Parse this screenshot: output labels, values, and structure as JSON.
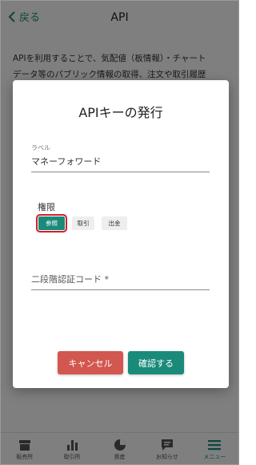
{
  "header": {
    "back_label": "戻る",
    "title": "API"
  },
  "background": {
    "line1": "APIを利用することで、気配値（板情報）・チャート",
    "line2": "データ等のパブリック情報の取得、注文や取引履歴"
  },
  "tabbar": {
    "tabs": [
      {
        "label": "販売所",
        "icon": "store-icon"
      },
      {
        "label": "取引所",
        "icon": "bar-chart-icon"
      },
      {
        "label": "資産",
        "icon": "pie-chart-icon"
      },
      {
        "label": "お知らせ",
        "icon": "message-icon"
      },
      {
        "label": "メニュー",
        "icon": "menu-icon"
      }
    ],
    "active_index": 4
  },
  "modal": {
    "title": "APIキーの発行",
    "label_field": {
      "label": "ラベル",
      "value": "マネーフォワード"
    },
    "permissions": {
      "heading": "権限",
      "options": [
        "参照",
        "取引",
        "出金"
      ],
      "selected": "参照"
    },
    "code_field": {
      "placeholder": "二段階認証コード *"
    },
    "cancel_label": "キャンセル",
    "confirm_label": "確認する"
  },
  "colors": {
    "accent": "#1a8a7a",
    "cancel": "#d2574f",
    "highlight": "#d0202a"
  }
}
